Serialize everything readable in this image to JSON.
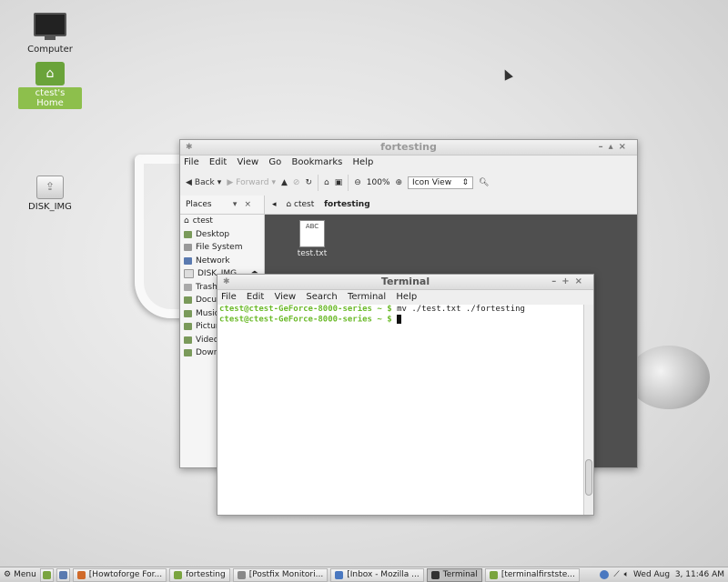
{
  "desktop": {
    "icons": [
      {
        "label": "Computer",
        "icon": "computer-icon"
      },
      {
        "label": "ctest's Home",
        "icon": "home-folder-icon"
      },
      {
        "label": "DISK_IMG",
        "icon": "drive-icon"
      }
    ]
  },
  "file_manager": {
    "title": "fortesting",
    "menu": [
      "File",
      "Edit",
      "View",
      "Go",
      "Bookmarks",
      "Help"
    ],
    "toolbar": {
      "back": "Back",
      "forward": "Forward",
      "zoom": "100%",
      "view_mode": "Icon View"
    },
    "places_label": "Places",
    "places": [
      "ctest",
      "Desktop",
      "File System",
      "Network",
      "DISK_IMG",
      "Trash",
      "Documents",
      "Music",
      "Pictures",
      "Videos",
      "Downloads"
    ],
    "path": [
      "ctest",
      "fortesting"
    ],
    "files": [
      {
        "name": "test.txt",
        "thumb": "ABC"
      }
    ]
  },
  "terminal": {
    "title": "Terminal",
    "menu": [
      "File",
      "Edit",
      "View",
      "Search",
      "Terminal",
      "Help"
    ],
    "lines": [
      {
        "prompt": "ctest@ctest-GeForce-8000-series ~ $",
        "command": " mv ./test.txt ./fortesting"
      },
      {
        "prompt": "ctest@ctest-GeForce-8000-series ~ $",
        "command": " "
      }
    ]
  },
  "taskbar": {
    "menu_label": "Menu",
    "tasks": [
      {
        "label": "[Howtoforge For...",
        "icon_color": "#d06a2a"
      },
      {
        "label": "fortesting",
        "icon_color": "#7aa43f"
      },
      {
        "label": "[Postfix Monitori...",
        "icon_color": "#888888"
      },
      {
        "label": "[Inbox - Mozilla ...",
        "icon_color": "#4a78c0"
      },
      {
        "label": "Terminal",
        "icon_color": "#333333"
      },
      {
        "label": "[terminalfirstste...",
        "icon_color": "#7aa43f"
      }
    ],
    "clock": "Wed Aug  3, 11:46 AM"
  }
}
